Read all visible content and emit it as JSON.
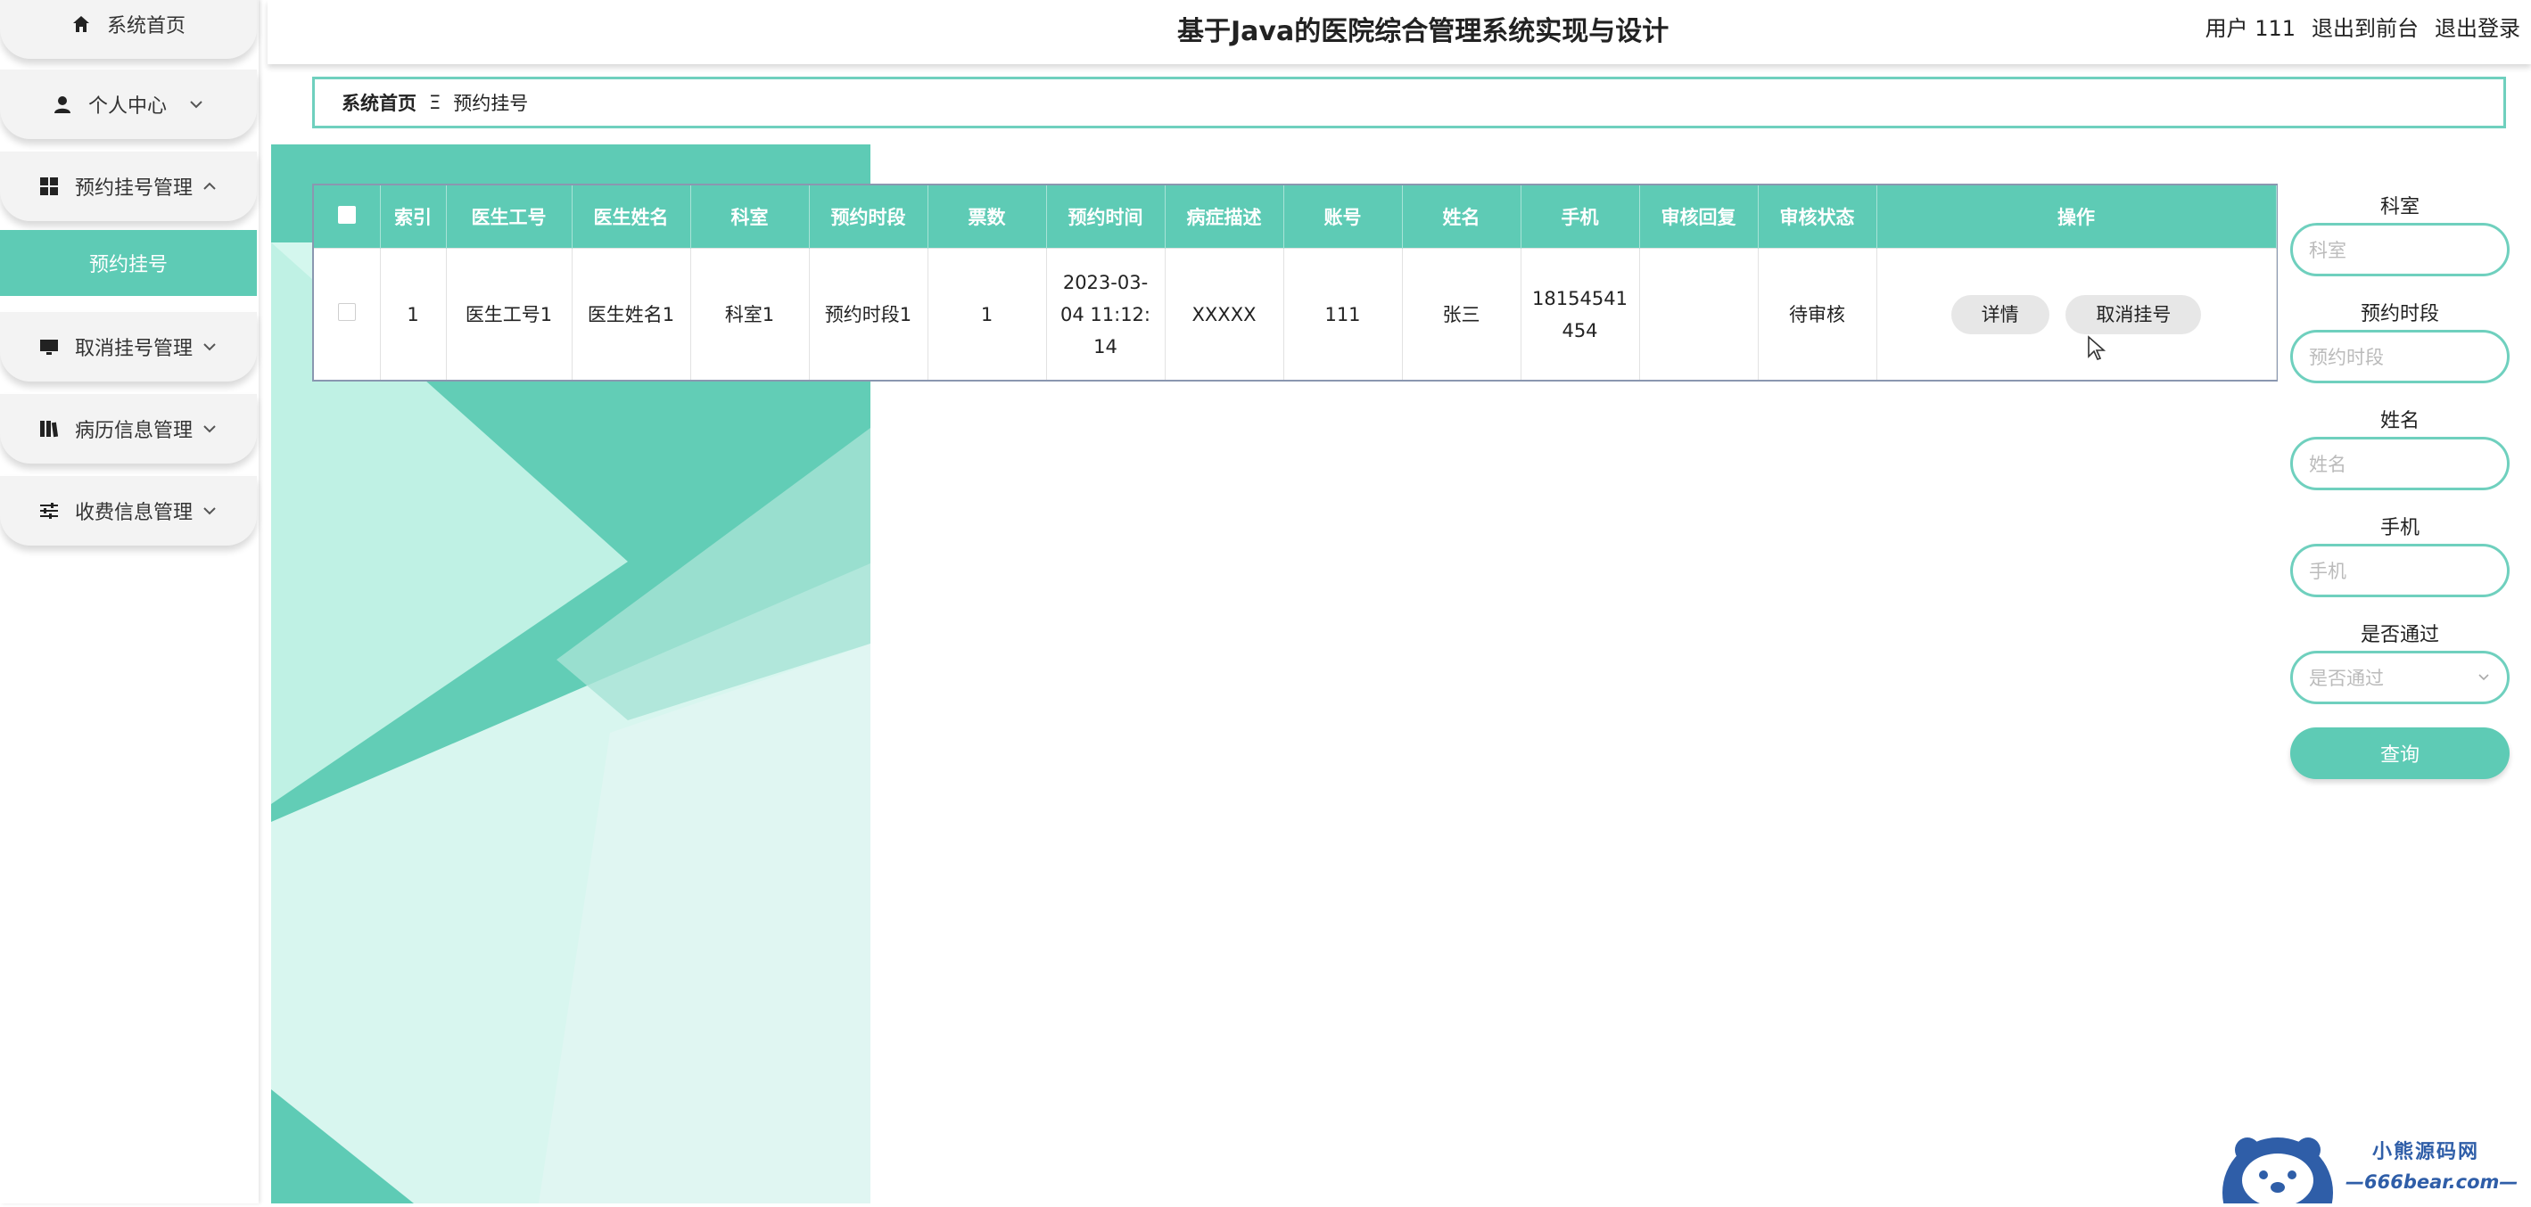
{
  "header": {
    "title": "基于Java的医院综合管理系统实现与设计",
    "user_label": "用户 111",
    "back_front": "退出到前台",
    "logout": "退出登录"
  },
  "sidebar": {
    "items": [
      {
        "label": "系统首页",
        "icon": "home-icon"
      },
      {
        "label": "个人中心",
        "icon": "user-icon"
      },
      {
        "label": "预约挂号管理",
        "icon": "grid-icon"
      },
      {
        "label": "取消挂号管理",
        "icon": "monitor-icon"
      },
      {
        "label": "病历信息管理",
        "icon": "book-icon"
      },
      {
        "label": "收费信息管理",
        "icon": "sliders-icon"
      }
    ],
    "active_sub": "预约挂号"
  },
  "breadcrumb": {
    "home": "系统首页",
    "separator": "Ξ",
    "current": "预约挂号"
  },
  "table": {
    "headers": [
      "索引",
      "医生工号",
      "医生姓名",
      "科室",
      "预约时段",
      "票数",
      "预约时间",
      "病症描述",
      "账号",
      "姓名",
      "手机",
      "审核回复",
      "审核状态",
      "操作"
    ],
    "rows": [
      {
        "index": "1",
        "doctor_id": "医生工号1",
        "doctor_name": "医生姓名1",
        "department": "科室1",
        "time_slot": "预约时段1",
        "tickets": "1",
        "appointment_time_line1": "2023-03-",
        "appointment_time_line2": "04 11:12:",
        "appointment_time_line3": "14",
        "description": "XXXXX",
        "account": "111",
        "name": "张三",
        "phone_line1": "18154541",
        "phone_line2": "454",
        "reply": "",
        "status": "待审核",
        "detail_button": "详情",
        "cancel_button": "取消挂号"
      }
    ]
  },
  "search": {
    "department_label": "科室",
    "department_placeholder": "科室",
    "slot_label": "预约时段",
    "slot_placeholder": "预约时段",
    "name_label": "姓名",
    "name_placeholder": "姓名",
    "phone_label": "手机",
    "phone_placeholder": "手机",
    "pass_label": "是否通过",
    "pass_placeholder": "是否通过",
    "query_button": "查询"
  },
  "watermark": {
    "line1": "小熊源码网",
    "line2": "—666bear.com—"
  },
  "colors": {
    "accent": "#5ecbb5",
    "border": "#6fd0be",
    "logo": "#2f5ea8"
  }
}
